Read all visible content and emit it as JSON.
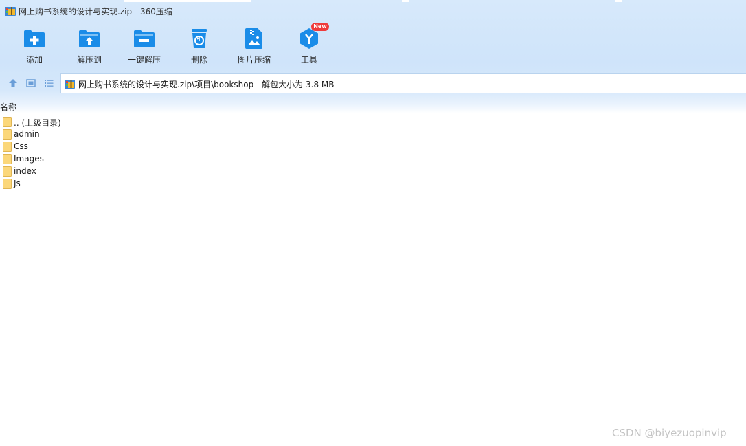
{
  "window": {
    "title": "网上购书系统的设计与实现.zip - 360压缩"
  },
  "toolbar": {
    "items": [
      {
        "label": "添加",
        "icon": "add-icon"
      },
      {
        "label": "解压到",
        "icon": "extract-to-icon"
      },
      {
        "label": "一键解压",
        "icon": "one-click-extract-icon"
      },
      {
        "label": "删除",
        "icon": "delete-icon"
      },
      {
        "label": "图片压缩",
        "icon": "image-compress-icon"
      },
      {
        "label": "工具",
        "icon": "tools-icon"
      }
    ],
    "new_badge": "New"
  },
  "address": {
    "path": "网上购书系统的设计与实现.zip\\项目\\bookshop - 解包大小为 3.8 MB"
  },
  "file_list": {
    "column_header": "名称",
    "rows": [
      {
        "name": ".. (上级目录)"
      },
      {
        "name": "admin"
      },
      {
        "name": "Css"
      },
      {
        "name": "Images"
      },
      {
        "name": "index"
      },
      {
        "name": "Js"
      }
    ]
  },
  "watermark": "CSDN @biyezuopinvip",
  "colors": {
    "accent": "#1a8ce8",
    "folder": "#fbd77a",
    "badge": "#ef3b3b"
  }
}
